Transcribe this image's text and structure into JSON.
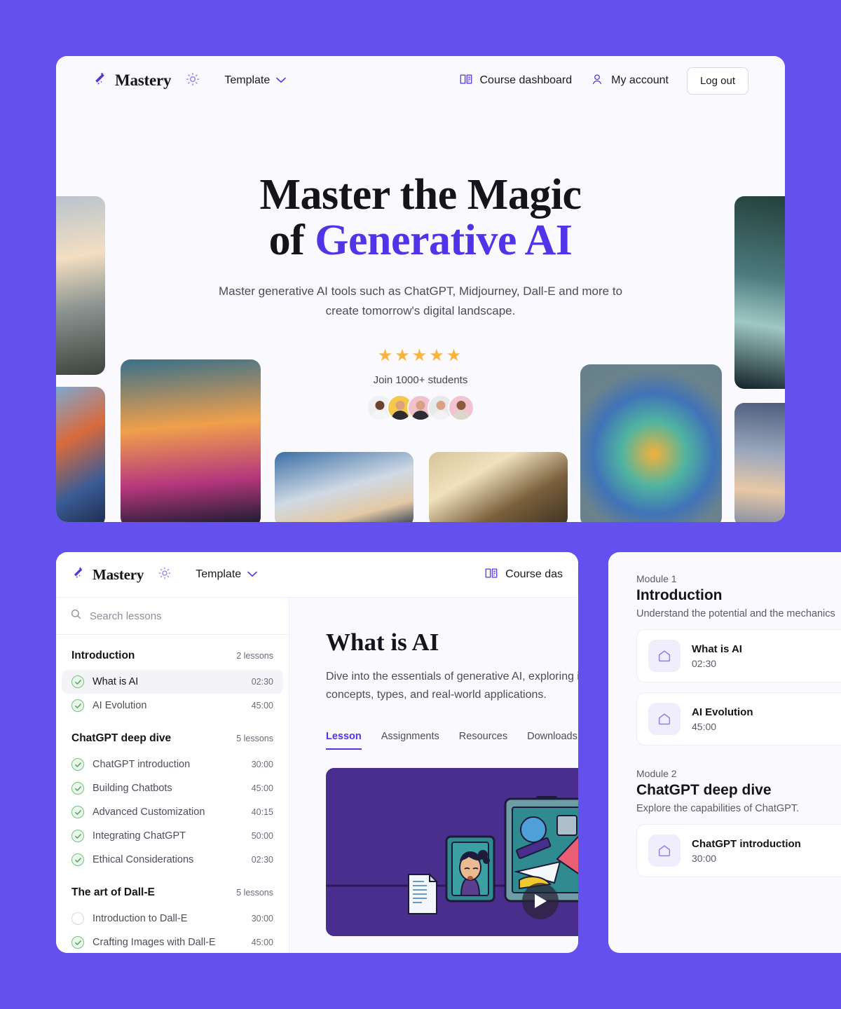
{
  "theme": {
    "background": "#6350ee",
    "accent": "#5333e8",
    "star_color": "#f8b43c",
    "check_green": "#72c37a"
  },
  "hero_window": {
    "navbar": {
      "brand": "Mastery",
      "brand_icon": "magic-wand-icon",
      "theme_toggle_icon": "sun-icon",
      "template_label": "Template",
      "template_caret_icon": "chevron-down-icon",
      "course_dashboard_icon": "book-icon",
      "course_dashboard_label": "Course dashboard",
      "my_account_icon": "user-icon",
      "my_account_label": "My account",
      "logout_label": "Log out"
    },
    "hero": {
      "title_line1": "Master the Magic",
      "title_line2_prefix": "of ",
      "title_line2_accent": "Generative AI",
      "subtitle": "Master generative AI tools such as ChatGPT, Midjourney, Dall-E and more to create tomorrow's digital landscape.",
      "stars": "★★★★★",
      "star_count": 5,
      "join_text": "Join 1000+ students",
      "avatars": [
        {
          "name": "student-avatar-1",
          "bg": "#eef0f2",
          "skin": "#6b4330",
          "shirt": "#f4f5f7"
        },
        {
          "name": "student-avatar-2",
          "bg": "#f5c84a",
          "skin": "#d9a27c",
          "shirt": "#2c2b33"
        },
        {
          "name": "student-avatar-3",
          "bg": "#f2c2cf",
          "skin": "#d8a183",
          "shirt": "#2e2d35"
        },
        {
          "name": "student-avatar-4",
          "bg": "#e8e9eb",
          "skin": "#d8a183",
          "shirt": "#f2f2f4"
        },
        {
          "name": "student-avatar-5",
          "bg": "#f3c3d3",
          "skin": "#8a5a3c",
          "shirt": "#ded6cb"
        }
      ],
      "gallery": [
        {
          "name": "gallery-image-misty-mountains",
          "c1": "#c8cfd6",
          "c2": "#f0d9b8",
          "c3": "#4d5552"
        },
        {
          "name": "gallery-image-colorful-city",
          "c1": "#3b6ea8",
          "c2": "#e06b3a",
          "c3": "#2b3f66"
        },
        {
          "name": "gallery-image-cyberpunk-skyline",
          "c1": "#2b5d72",
          "c2": "#f0a04b",
          "c3": "#d0347f"
        },
        {
          "name": "gallery-image-cloud-tower",
          "c1": "#3f6ea3",
          "c2": "#e8d3b0",
          "c3": "#1e3354"
        },
        {
          "name": "gallery-image-portrait-clouds",
          "c1": "#8e6a3e",
          "c2": "#e8d6ae",
          "c3": "#4a3b26"
        },
        {
          "name": "gallery-image-color-swirl",
          "c1": "#65808a",
          "c2": "#f2b23a",
          "c3": "#3f7ab0"
        },
        {
          "name": "gallery-image-enchanted-forest",
          "c1": "#1f3a36",
          "c2": "#6f9ba0",
          "c3": "#0e1f24"
        },
        {
          "name": "gallery-image-floating-islands",
          "c1": "#54637f",
          "c2": "#e7c6a8",
          "c3": "#2d3a52"
        }
      ]
    }
  },
  "course_window": {
    "navbar": {
      "brand": "Mastery",
      "brand_icon": "magic-wand-icon",
      "theme_toggle_icon": "sun-icon",
      "template_label": "Template",
      "template_caret_icon": "chevron-down-icon",
      "course_dashboard_icon": "book-icon",
      "course_dashboard_label": "Course das"
    },
    "sidebar": {
      "search_icon": "search-icon",
      "search_placeholder": "Search lessons",
      "search_value": "",
      "sections": [
        {
          "title": "Introduction",
          "count": "2 lessons",
          "lessons": [
            {
              "name": "What is AI",
              "time": "02:30",
              "done": true,
              "active": true
            },
            {
              "name": "AI Evolution",
              "time": "45:00",
              "done": true,
              "active": false
            }
          ]
        },
        {
          "title": "ChatGPT deep dive",
          "count": "5 lessons",
          "lessons": [
            {
              "name": "ChatGPT introduction",
              "time": "30:00",
              "done": true,
              "active": false
            },
            {
              "name": "Building Chatbots",
              "time": "45:00",
              "done": true,
              "active": false
            },
            {
              "name": "Advanced Customization",
              "time": "40:15",
              "done": true,
              "active": false
            },
            {
              "name": "Integrating ChatGPT",
              "time": "50:00",
              "done": true,
              "active": false
            },
            {
              "name": "Ethical Considerations",
              "time": "02:30",
              "done": true,
              "active": false
            }
          ]
        },
        {
          "title": "The art of Dall-E",
          "count": "5 lessons",
          "lessons": [
            {
              "name": "Introduction to Dall-E",
              "time": "30:00",
              "done": false,
              "active": false
            },
            {
              "name": "Crafting Images with Dall-E",
              "time": "45:00",
              "done": true,
              "active": false
            }
          ]
        }
      ]
    },
    "main": {
      "lesson_title": "What is AI",
      "lesson_desc": "Dive into the essentials of generative AI, exploring its concepts, types, and real-world applications.",
      "tabs": [
        {
          "label": "Lesson",
          "active": true
        },
        {
          "label": "Assignments",
          "active": false
        },
        {
          "label": "Resources",
          "active": false
        },
        {
          "label": "Downloads",
          "active": false
        }
      ],
      "video": {
        "play_icon": "play-button-icon",
        "background": "#4a2e8e"
      }
    }
  },
  "modules_window": {
    "modules": [
      {
        "kicker": "Module 1",
        "title": "Introduction",
        "desc": "Understand the potential and the mechanics",
        "lessons": [
          {
            "icon": "home-icon",
            "name": "What is AI",
            "time": "02:30"
          },
          {
            "icon": "home-icon",
            "name": "AI Evolution",
            "time": "45:00"
          }
        ]
      },
      {
        "kicker": "Module 2",
        "title": "ChatGPT deep dive",
        "desc": "Explore the capabilities of ChatGPT.",
        "lessons": [
          {
            "icon": "home-icon",
            "name": "ChatGPT introduction",
            "time": "30:00"
          }
        ]
      }
    ]
  }
}
